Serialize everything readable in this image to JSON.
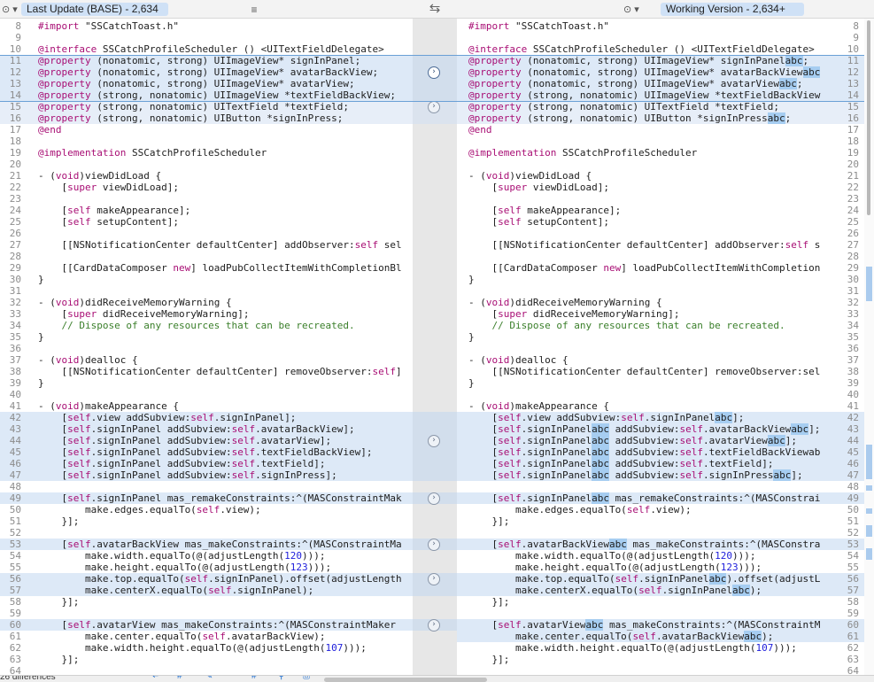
{
  "toolbar": {
    "left_file": "Last Update (BASE) - 2,634",
    "right_file": "Working Version - 2,634+",
    "swap_glyph": "⇆",
    "menu_glyph": "≡",
    "selector_glyph": "⊙ ▾"
  },
  "status": {
    "differences": "26 differences",
    "icons": [
      "arrow-return-icon",
      "hash-icon",
      "pencil-icon",
      "chevron-up-icon",
      "hash-icon",
      "filter-icon",
      "printer-icon"
    ]
  },
  "left_lines": [
    {
      "n": "8",
      "t": "#import \"SSCatchToast.h\"",
      "c": ""
    },
    {
      "n": "9",
      "t": "",
      "c": ""
    },
    {
      "n": "10",
      "t": "@interface SSCatchProfileScheduler () <UITextFieldDelegate>",
      "c": ""
    },
    {
      "n": "11",
      "t": "@property (nonatomic, strong) UIImageView* signInPanel;",
      "c": "hl"
    },
    {
      "n": "12",
      "t": "@property (nonatomic, strong) UIImageView* avatarBackView;",
      "c": "hl"
    },
    {
      "n": "13",
      "t": "@property (nonatomic, strong) UIImageView* avatarView;",
      "c": "hl"
    },
    {
      "n": "14",
      "t": "@property (strong, nonatomic) UIImageView *textFieldBackView;",
      "c": "hl"
    },
    {
      "n": "15",
      "t": "@property (strong, nonatomic) UITextField *textField;",
      "c": "hl2"
    },
    {
      "n": "16",
      "t": "@property (strong, nonatomic) UIButton *signInPress;",
      "c": "hl2"
    },
    {
      "n": "17",
      "t": "@end",
      "c": ""
    },
    {
      "n": "18",
      "t": "",
      "c": ""
    },
    {
      "n": "19",
      "t": "@implementation SSCatchProfileScheduler",
      "c": ""
    },
    {
      "n": "20",
      "t": "",
      "c": ""
    },
    {
      "n": "21",
      "t": "- (void)viewDidLoad {",
      "c": ""
    },
    {
      "n": "22",
      "t": "    [super viewDidLoad];",
      "c": ""
    },
    {
      "n": "23",
      "t": "",
      "c": ""
    },
    {
      "n": "24",
      "t": "    [self makeAppearance];",
      "c": ""
    },
    {
      "n": "25",
      "t": "    [self setupContent];",
      "c": ""
    },
    {
      "n": "26",
      "t": "",
      "c": ""
    },
    {
      "n": "27",
      "t": "    [[NSNotificationCenter defaultCenter] addObserver:self sel",
      "c": ""
    },
    {
      "n": "28",
      "t": "",
      "c": ""
    },
    {
      "n": "29",
      "t": "    [[CardDataComposer new] loadPubCollectItemWithCompletionBl",
      "c": ""
    },
    {
      "n": "30",
      "t": "}",
      "c": ""
    },
    {
      "n": "31",
      "t": "",
      "c": ""
    },
    {
      "n": "32",
      "t": "- (void)didReceiveMemoryWarning {",
      "c": ""
    },
    {
      "n": "33",
      "t": "    [super didReceiveMemoryWarning];",
      "c": ""
    },
    {
      "n": "34",
      "t": "    // Dispose of any resources that can be recreated.",
      "c": ""
    },
    {
      "n": "35",
      "t": "}",
      "c": ""
    },
    {
      "n": "36",
      "t": "",
      "c": ""
    },
    {
      "n": "37",
      "t": "- (void)dealloc {",
      "c": ""
    },
    {
      "n": "38",
      "t": "    [[NSNotificationCenter defaultCenter] removeObserver:self]",
      "c": ""
    },
    {
      "n": "39",
      "t": "}",
      "c": ""
    },
    {
      "n": "40",
      "t": "",
      "c": ""
    },
    {
      "n": "41",
      "t": "- (void)makeAppearance {",
      "c": ""
    },
    {
      "n": "42",
      "t": "    [self.view addSubview:self.signInPanel];",
      "c": "hl"
    },
    {
      "n": "43",
      "t": "    [self.signInPanel addSubview:self.avatarBackView];",
      "c": "hl"
    },
    {
      "n": "44",
      "t": "    [self.signInPanel addSubview:self.avatarView];",
      "c": "hl"
    },
    {
      "n": "45",
      "t": "    [self.signInPanel addSubview:self.textFieldBackView];",
      "c": "hl"
    },
    {
      "n": "46",
      "t": "    [self.signInPanel addSubview:self.textField];",
      "c": "hl"
    },
    {
      "n": "47",
      "t": "    [self.signInPanel addSubview:self.signInPress];",
      "c": "hl"
    },
    {
      "n": "48",
      "t": "",
      "c": ""
    },
    {
      "n": "49",
      "t": "    [self.signInPanel mas_remakeConstraints:^(MASConstraintMak",
      "c": "hl"
    },
    {
      "n": "50",
      "t": "        make.edges.equalTo(self.view);",
      "c": ""
    },
    {
      "n": "51",
      "t": "    }];",
      "c": ""
    },
    {
      "n": "52",
      "t": "",
      "c": ""
    },
    {
      "n": "53",
      "t": "    [self.avatarBackView mas_makeConstraints:^(MASConstraintMa",
      "c": "hl"
    },
    {
      "n": "54",
      "t": "        make.width.equalTo(@(adjustLength(120)));",
      "c": ""
    },
    {
      "n": "55",
      "t": "        make.height.equalTo(@(adjustLength(123)));",
      "c": ""
    },
    {
      "n": "56",
      "t": "        make.top.equalTo(self.signInPanel).offset(adjustLength",
      "c": "hl"
    },
    {
      "n": "57",
      "t": "        make.centerX.equalTo(self.signInPanel);",
      "c": "hl"
    },
    {
      "n": "58",
      "t": "    }];",
      "c": ""
    },
    {
      "n": "59",
      "t": "",
      "c": ""
    },
    {
      "n": "60",
      "t": "    [self.avatarView mas_makeConstraints:^(MASConstraintMaker",
      "c": "hl"
    },
    {
      "n": "61",
      "t": "        make.center.equalTo(self.avatarBackView);",
      "c": ""
    },
    {
      "n": "62",
      "t": "        make.width.height.equalTo(@(adjustLength(107)));",
      "c": ""
    },
    {
      "n": "63",
      "t": "    }];",
      "c": ""
    },
    {
      "n": "64",
      "t": "",
      "c": ""
    }
  ],
  "right_lines": [
    {
      "n": "8",
      "t": "#import \"SSCatchToast.h\"",
      "c": ""
    },
    {
      "n": "9",
      "t": "",
      "c": ""
    },
    {
      "n": "10",
      "t": "@interface SSCatchProfileScheduler () <UITextFieldDelegate>",
      "c": ""
    },
    {
      "n": "11",
      "t": "@property (nonatomic, strong) UIImageView* signInPanel[abc];",
      "c": "hl"
    },
    {
      "n": "12",
      "t": "@property (nonatomic, strong) UIImageView* avatarBackView[abc]",
      "c": "hl"
    },
    {
      "n": "13",
      "t": "@property (nonatomic, strong) UIImageView* avatarView[abc];",
      "c": "hl"
    },
    {
      "n": "14",
      "t": "@property (strong, nonatomic) UIImageView *textFieldBackView",
      "c": "hl"
    },
    {
      "n": "15",
      "t": "@property (strong, nonatomic) UITextField *textField;",
      "c": "hl2"
    },
    {
      "n": "16",
      "t": "@property (strong, nonatomic) UIButton *signInPress[abc];",
      "c": "hl2"
    },
    {
      "n": "17",
      "t": "@end",
      "c": ""
    },
    {
      "n": "18",
      "t": "",
      "c": ""
    },
    {
      "n": "19",
      "t": "@implementation SSCatchProfileScheduler",
      "c": ""
    },
    {
      "n": "20",
      "t": "",
      "c": ""
    },
    {
      "n": "21",
      "t": "- (void)viewDidLoad {",
      "c": ""
    },
    {
      "n": "22",
      "t": "    [super viewDidLoad];",
      "c": ""
    },
    {
      "n": "23",
      "t": "",
      "c": ""
    },
    {
      "n": "24",
      "t": "    [self makeAppearance];",
      "c": ""
    },
    {
      "n": "25",
      "t": "    [self setupContent];",
      "c": ""
    },
    {
      "n": "26",
      "t": "",
      "c": ""
    },
    {
      "n": "27",
      "t": "    [[NSNotificationCenter defaultCenter] addObserver:self s",
      "c": ""
    },
    {
      "n": "28",
      "t": "",
      "c": ""
    },
    {
      "n": "29",
      "t": "    [[CardDataComposer new] loadPubCollectItemWithCompletion",
      "c": ""
    },
    {
      "n": "30",
      "t": "}",
      "c": ""
    },
    {
      "n": "31",
      "t": "",
      "c": ""
    },
    {
      "n": "32",
      "t": "- (void)didReceiveMemoryWarning {",
      "c": ""
    },
    {
      "n": "33",
      "t": "    [super didReceiveMemoryWarning];",
      "c": ""
    },
    {
      "n": "34",
      "t": "    // Dispose of any resources that can be recreated.",
      "c": ""
    },
    {
      "n": "35",
      "t": "}",
      "c": ""
    },
    {
      "n": "36",
      "t": "",
      "c": ""
    },
    {
      "n": "37",
      "t": "- (void)dealloc {",
      "c": ""
    },
    {
      "n": "38",
      "t": "    [[NSNotificationCenter defaultCenter] removeObserver:sel",
      "c": ""
    },
    {
      "n": "39",
      "t": "}",
      "c": ""
    },
    {
      "n": "40",
      "t": "",
      "c": ""
    },
    {
      "n": "41",
      "t": "- (void)makeAppearance {",
      "c": ""
    },
    {
      "n": "42",
      "t": "    [self.view addSubview:self.signInPanel[abc]];",
      "c": "hl"
    },
    {
      "n": "43",
      "t": "    [self.signInPanel[abc] addSubview:self.avatarBackView[abc]];",
      "c": "hl"
    },
    {
      "n": "44",
      "t": "    [self.signInPanel[abc] addSubview:self.avatarView[abc]];",
      "c": "hl"
    },
    {
      "n": "45",
      "t": "    [self.signInPanel[abc] addSubview:self.textFieldBackViewab",
      "c": "hl"
    },
    {
      "n": "46",
      "t": "    [self.signInPanel[abc] addSubview:self.textField];",
      "c": "hl"
    },
    {
      "n": "47",
      "t": "    [self.signInPanel[abc] addSubview:self.signInPress[abc]];",
      "c": "hl"
    },
    {
      "n": "48",
      "t": "",
      "c": ""
    },
    {
      "n": "49",
      "t": "    [self.signInPanel[abc] mas_remakeConstraints:^(MASConstrai",
      "c": "hl"
    },
    {
      "n": "50",
      "t": "        make.edges.equalTo(self.view);",
      "c": ""
    },
    {
      "n": "51",
      "t": "    }];",
      "c": ""
    },
    {
      "n": "52",
      "t": "",
      "c": ""
    },
    {
      "n": "53",
      "t": "    [self.avatarBackView[abc] mas_makeConstraints:^(MASConstra",
      "c": "hl"
    },
    {
      "n": "54",
      "t": "        make.width.equalTo(@(adjustLength(120)));",
      "c": ""
    },
    {
      "n": "55",
      "t": "        make.height.equalTo(@(adjustLength(123)));",
      "c": ""
    },
    {
      "n": "56",
      "t": "        make.top.equalTo(self.signInPanel[abc]).offset(adjustL",
      "c": "hl"
    },
    {
      "n": "57",
      "t": "        make.centerX.equalTo(self.signInPanel[abc]);",
      "c": "hl"
    },
    {
      "n": "58",
      "t": "    }];",
      "c": ""
    },
    {
      "n": "59",
      "t": "",
      "c": ""
    },
    {
      "n": "60",
      "t": "    [self.avatarView[abc] mas_makeConstraints:^(MASConstraintM",
      "c": "hl"
    },
    {
      "n": "61",
      "t": "        make.center.equalTo(self.avatarBackView[abc]);",
      "c": "hl"
    },
    {
      "n": "62",
      "t": "        make.width.height.equalTo(@(adjustLength(107)));",
      "c": ""
    },
    {
      "n": "63",
      "t": "    }];",
      "c": ""
    },
    {
      "n": "64",
      "t": "",
      "c": ""
    }
  ],
  "gutter_buttons": [
    {
      "line": "12",
      "glyph": "›",
      "active": true
    },
    {
      "line": "15",
      "glyph": "›",
      "active": false
    },
    {
      "line": "44",
      "glyph": "›",
      "active": false
    },
    {
      "line": "49",
      "glyph": "›",
      "active": false
    },
    {
      "line": "53",
      "glyph": "›",
      "active": false
    },
    {
      "line": "56",
      "glyph": "›",
      "active": false
    },
    {
      "line": "60",
      "glyph": "›",
      "active": false
    }
  ]
}
